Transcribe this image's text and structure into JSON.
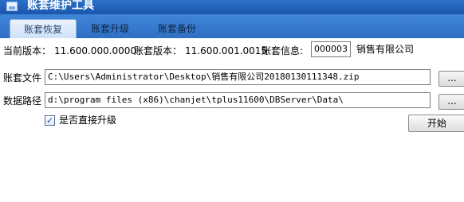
{
  "window": {
    "title": "账套维护工具",
    "icon": "app-window-icon"
  },
  "tabs": [
    {
      "label": "账套恢复",
      "active": true
    },
    {
      "label": "账套升级",
      "active": false
    },
    {
      "label": "账套备份",
      "active": false
    }
  ],
  "info": {
    "current_version_label": "当前版本：",
    "current_version": "11.600.000.0000",
    "account_version_label": "账套版本：",
    "account_version": "11.600.001.0015",
    "account_info_label": "账套信息:",
    "account_code": "000003",
    "company_name": "销售有限公司"
  },
  "fields": {
    "account_file_label": "账套文件",
    "account_file_value": "C:\\Users\\Administrator\\Desktop\\销售有限公司20180130111348.zip",
    "data_path_label": "数据路径",
    "data_path_value": "d:\\program files (x86)\\chanjet\\tplus11600\\DBServer\\Data\\"
  },
  "browse_label": "...",
  "checkbox": {
    "label": "是否直接升级",
    "checked": true,
    "mark": "✓"
  },
  "start_label": "开始",
  "colors": {
    "title_bar": "#1f5fb8",
    "tab_bar": "#3a80d4",
    "tab_active": "#dce9fa"
  }
}
